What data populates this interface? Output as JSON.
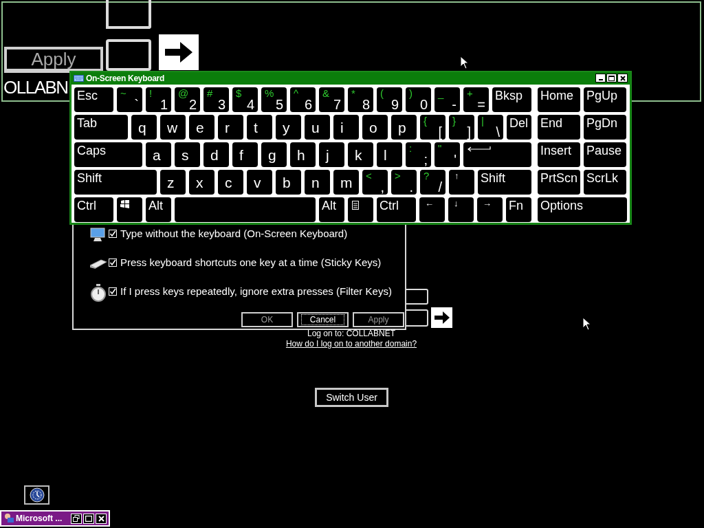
{
  "magnifier": {
    "apply_button": {
      "label": "Apply",
      "disabled": true
    },
    "domain_text": "OLLABN"
  },
  "keyboard": {
    "title": "On-Screen Keyboard",
    "rows": [
      {
        "main": [
          {
            "kind": "label",
            "label": "Esc"
          },
          {
            "kind": "dual",
            "shift": "~",
            "base": "`"
          },
          {
            "kind": "dual",
            "shift": "!",
            "base": "1"
          },
          {
            "kind": "dual",
            "shift": "@",
            "base": "2"
          },
          {
            "kind": "dual",
            "shift": "#",
            "base": "3"
          },
          {
            "kind": "dual",
            "shift": "$",
            "base": "4"
          },
          {
            "kind": "dual",
            "shift": "%",
            "base": "5"
          },
          {
            "kind": "dual",
            "shift": "^",
            "base": "6"
          },
          {
            "kind": "dual",
            "shift": "&",
            "base": "7"
          },
          {
            "kind": "dual",
            "shift": "*",
            "base": "8"
          },
          {
            "kind": "dual",
            "shift": "(",
            "base": "9"
          },
          {
            "kind": "dual",
            "shift": ")",
            "base": "0"
          },
          {
            "kind": "dual",
            "shift": "_",
            "base": "-"
          },
          {
            "kind": "dual",
            "shift": "+",
            "base": "="
          },
          {
            "kind": "label",
            "label": "Bksp"
          }
        ],
        "side": [
          {
            "kind": "label",
            "label": "Home"
          },
          {
            "kind": "label",
            "label": "PgUp"
          }
        ]
      },
      {
        "main": [
          {
            "kind": "label",
            "label": "Tab"
          },
          {
            "kind": "char",
            "label": "q"
          },
          {
            "kind": "char",
            "label": "w"
          },
          {
            "kind": "char",
            "label": "e"
          },
          {
            "kind": "char",
            "label": "r"
          },
          {
            "kind": "char",
            "label": "t"
          },
          {
            "kind": "char",
            "label": "y"
          },
          {
            "kind": "char",
            "label": "u"
          },
          {
            "kind": "char",
            "label": "i"
          },
          {
            "kind": "char",
            "label": "o"
          },
          {
            "kind": "char",
            "label": "p"
          },
          {
            "kind": "dual",
            "shift": "{",
            "base": "["
          },
          {
            "kind": "dual",
            "shift": "}",
            "base": "]"
          },
          {
            "kind": "dual",
            "shift": "|",
            "base": "\\"
          },
          {
            "kind": "label",
            "label": "Del"
          }
        ],
        "side": [
          {
            "kind": "label",
            "label": "End"
          },
          {
            "kind": "label",
            "label": "PgDn"
          }
        ]
      },
      {
        "main": [
          {
            "kind": "label",
            "label": "Caps"
          },
          {
            "kind": "char",
            "label": "a"
          },
          {
            "kind": "char",
            "label": "s"
          },
          {
            "kind": "char",
            "label": "d"
          },
          {
            "kind": "char",
            "label": "f"
          },
          {
            "kind": "char",
            "label": "g"
          },
          {
            "kind": "char",
            "label": "h"
          },
          {
            "kind": "char",
            "label": "j"
          },
          {
            "kind": "char",
            "label": "k"
          },
          {
            "kind": "char",
            "label": "l"
          },
          {
            "kind": "dual",
            "shift": ":",
            "base": ";"
          },
          {
            "kind": "dual",
            "shift": "\"",
            "base": "'"
          },
          {
            "kind": "enter"
          }
        ],
        "side": [
          {
            "kind": "label",
            "label": "Insert"
          },
          {
            "kind": "label",
            "label": "Pause"
          }
        ]
      },
      {
        "main": [
          {
            "kind": "label",
            "label": "Shift"
          },
          {
            "kind": "char",
            "label": "z"
          },
          {
            "kind": "char",
            "label": "x"
          },
          {
            "kind": "char",
            "label": "c"
          },
          {
            "kind": "char",
            "label": "v"
          },
          {
            "kind": "char",
            "label": "b"
          },
          {
            "kind": "char",
            "label": "n"
          },
          {
            "kind": "char",
            "label": "m"
          },
          {
            "kind": "dual",
            "shift": "<",
            "base": ","
          },
          {
            "kind": "dual",
            "shift": ">",
            "base": "."
          },
          {
            "kind": "dual",
            "shift": "?",
            "base": "/"
          },
          {
            "kind": "arrow",
            "label": "↑"
          },
          {
            "kind": "label",
            "label": "Shift"
          }
        ],
        "side": [
          {
            "kind": "label",
            "label": "PrtScn"
          },
          {
            "kind": "label",
            "label": "ScrLk"
          }
        ]
      },
      {
        "main": [
          {
            "kind": "label",
            "label": "Ctrl"
          },
          {
            "kind": "windows"
          },
          {
            "kind": "label",
            "label": "Alt"
          },
          {
            "kind": "space"
          },
          {
            "kind": "label",
            "label": "Alt"
          },
          {
            "kind": "menu"
          },
          {
            "kind": "label",
            "label": "Ctrl"
          },
          {
            "kind": "arrow",
            "label": "←"
          },
          {
            "kind": "arrow",
            "label": "↓"
          },
          {
            "kind": "arrow",
            "label": "→"
          },
          {
            "kind": "label",
            "label": "Fn"
          }
        ],
        "side": [
          {
            "kind": "label",
            "label": "Options"
          }
        ]
      }
    ]
  },
  "ease_dialog": {
    "options": [
      {
        "kind": "monitor",
        "label": "Type without the keyboard (On-Screen Keyboard)",
        "checked": true
      },
      {
        "kind": "keyboard",
        "label": "Press keyboard shortcuts one key at a time (Sticky Keys)",
        "checked": true
      },
      {
        "kind": "stopwatch",
        "label": "If I press keys repeatedly, ignore extra presses (Filter Keys)",
        "checked": true
      }
    ],
    "buttons": [
      {
        "label": "OK",
        "disabled": true,
        "focused": false
      },
      {
        "label": "Cancel",
        "disabled": false,
        "focused": true
      },
      {
        "label": "Apply",
        "disabled": true,
        "focused": false
      }
    ]
  },
  "logon": {
    "domain_line": "Log on to: COLLABNET",
    "help_link": "How do I log on to another domain?",
    "switch_user": "Switch User"
  },
  "minimized_window": {
    "title": "Microsoft ..."
  }
}
